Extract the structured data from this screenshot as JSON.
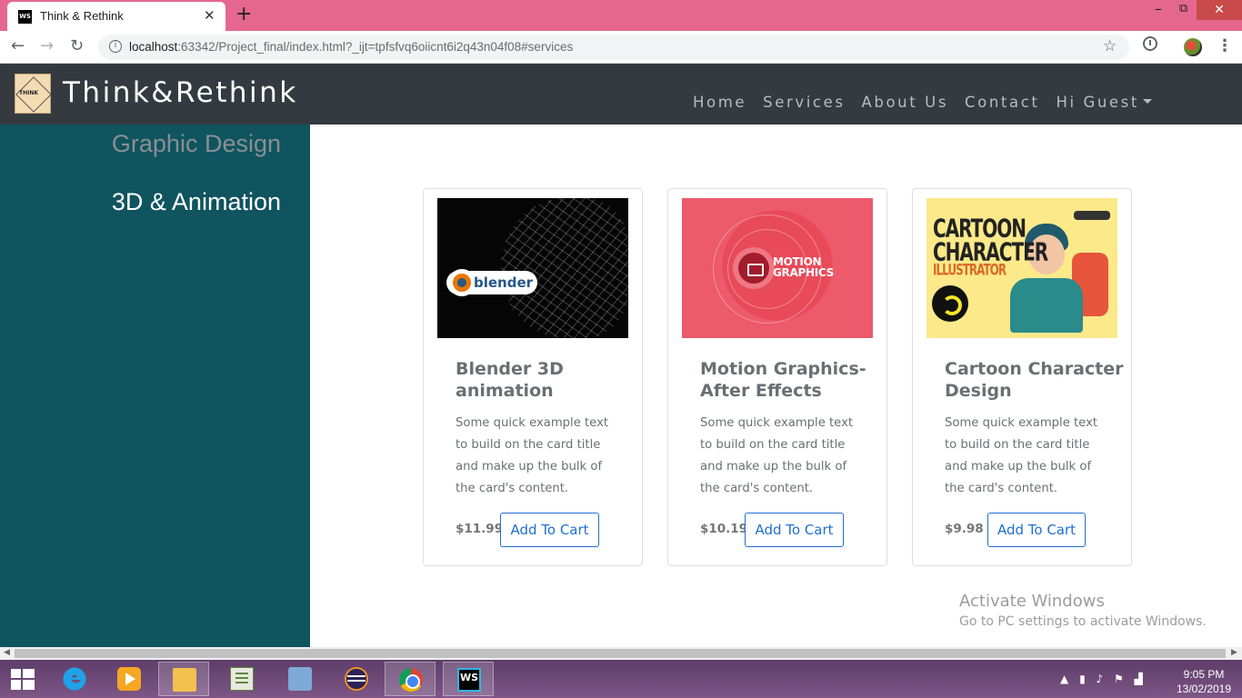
{
  "browser": {
    "tab_title": "Think & Rethink",
    "tab_favicon": "WS",
    "url_host": "localhost",
    "url_rest": ":63342/Project_final/index.html?_ijt=tpfsfvq6oiicnt6i2q43n04f08#services"
  },
  "site": {
    "brand": "Think&Rethink",
    "logo_text": "THINK",
    "nav": [
      "Home",
      "Services",
      "About Us",
      "Contact",
      "Hi Guest"
    ]
  },
  "sidebar": {
    "items": [
      "Graphic Design",
      "3D & Animation"
    ]
  },
  "cards": [
    {
      "title": "Blender 3D animation",
      "text": "Some quick example text to build on the card title and make up the bulk of the card's content.",
      "price": "$11.99",
      "button": "Add To Cart",
      "image_text": "blender"
    },
    {
      "title": "Motion Graphics-After Effects",
      "text": "Some quick example text to build on the card title and make up the bulk of the card's content.",
      "price": "$10.19",
      "button": "Add To Cart",
      "image_text_1": "MOTION",
      "image_text_2": "GRAPHICS"
    },
    {
      "title": "Cartoon Character Design",
      "text": "Some quick example text to build on the card title and make up the bulk of the card's content.",
      "price": "$9.98",
      "button": "Add To Cart",
      "image_text_1": "CARTOON",
      "image_text_2": "CHARACTER",
      "image_text_3": "ILLUSTRATOR"
    }
  ],
  "watermark": {
    "line1": "Activate Windows",
    "line2": "Go to PC settings to activate Windows."
  },
  "taskbar": {
    "time": "9:05 PM",
    "date": "13/02/2019",
    "ws_label": "WS"
  },
  "colors": {
    "tab_strip": "#e5678f",
    "navbar": "#343a40",
    "sidebar": "#0f545f",
    "button_accent": "#1f6fd1"
  }
}
